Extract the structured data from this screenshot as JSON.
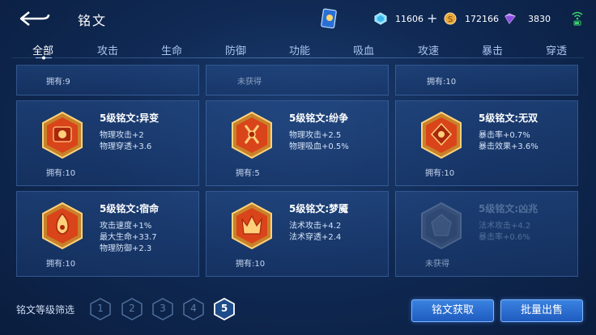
{
  "header": {
    "title": "铭文",
    "resources": [
      {
        "icon": "diamond-icon",
        "value": "11606",
        "plus": "+"
      },
      {
        "icon": "gold-coin-icon",
        "value": "172166"
      },
      {
        "icon": "crystal-icon",
        "value": "3830"
      }
    ]
  },
  "tabs": [
    "全部",
    "攻击",
    "生命",
    "防御",
    "功能",
    "吸血",
    "攻速",
    "暴击",
    "穿透"
  ],
  "top_row": {
    "col1": "拥有:9",
    "col2": "未获得",
    "col3": "拥有:10"
  },
  "runes": [
    {
      "name": "5级铭文:异变",
      "stats": [
        "物理攻击+2",
        "物理穿透+3.6"
      ],
      "owned": "拥有:10",
      "color": "#e04a1c"
    },
    {
      "name": "5级铭文:纷争",
      "stats": [
        "物理攻击+2.5",
        "物理吸血+0.5%"
      ],
      "owned": "拥有:5",
      "color": "#e04a1c"
    },
    {
      "name": "5级铭文:无双",
      "stats": [
        "暴击率+0.7%",
        "暴击效果+3.6%"
      ],
      "owned": "拥有:10",
      "color": "#e04a1c"
    },
    {
      "name": "5级铭文:宿命",
      "stats": [
        "攻击速度+1%",
        "最大生命+33.7",
        "物理防御+2.3"
      ],
      "owned": "拥有:10",
      "color": "#e04a1c"
    },
    {
      "name": "5级铭文:梦魇",
      "stats": [
        "法术攻击+4.2",
        "法术穿透+2.4"
      ],
      "owned": "拥有:10",
      "color": "#e04a1c"
    },
    {
      "name": "5级铭文:凶兆",
      "stats": [
        "法术攻击+4.2",
        "暴击率+0.6%"
      ],
      "owned": "未获得",
      "color": "#7a8aa0"
    }
  ],
  "footer": {
    "filter_label": "铭文等级筛选",
    "levels": [
      "1",
      "2",
      "3",
      "4",
      "5"
    ],
    "active_level": "5",
    "get_button": "铭文获取",
    "sell_button": "批量出售"
  }
}
